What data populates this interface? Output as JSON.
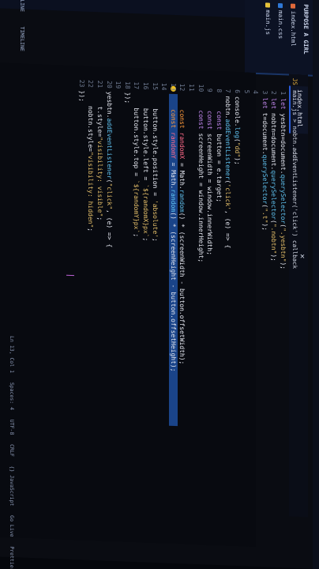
{
  "explorer": {
    "header": "PURPOSE A GIRL",
    "files": [
      {
        "label": "index.html",
        "color": "#e0693a"
      },
      {
        "label": "main.css",
        "color": "#2f78d6"
      },
      {
        "label": "main.js",
        "color": "#e6c23a"
      }
    ],
    "sections": [
      "OUTLINE",
      "TIMELINE"
    ]
  },
  "tab": {
    "label": "index.html"
  },
  "breadcrumb": {
    "file": "main.js",
    "sep1": ">",
    "symbol": "nobtn.addEventListener('click') callback"
  },
  "editor": {
    "lines": [
      {
        "n": "1",
        "tokens": [
          [
            "kw",
            "let "
          ],
          [
            "plain",
            "yesbtn"
          ],
          [
            "plain",
            "="
          ],
          [
            "plain",
            "document."
          ],
          [
            "fn",
            "querySelector"
          ],
          [
            "plain",
            "("
          ],
          [
            "str",
            "\".yesbtn\""
          ],
          [
            "plain",
            ");"
          ]
        ]
      },
      {
        "n": "2",
        "tokens": [
          [
            "kw",
            "let "
          ],
          [
            "plain",
            "nobtn"
          ],
          [
            "plain",
            "="
          ],
          [
            "plain",
            "document."
          ],
          [
            "fn",
            "querySelector"
          ],
          [
            "plain",
            "("
          ],
          [
            "str",
            "\".nobtn\""
          ],
          [
            "plain",
            ");"
          ]
        ]
      },
      {
        "n": "3",
        "tokens": [
          [
            "kw",
            "let "
          ],
          [
            "plain",
            "t"
          ],
          [
            "plain",
            "="
          ],
          [
            "plain",
            "document."
          ],
          [
            "fn",
            "querySelector"
          ],
          [
            "plain",
            "("
          ],
          [
            "str",
            "\".t\""
          ],
          [
            "plain",
            ");"
          ]
        ]
      },
      {
        "n": "4",
        "tokens": []
      },
      {
        "n": "5",
        "tokens": []
      },
      {
        "n": "6",
        "tokens": [
          [
            "plain",
            "console."
          ],
          [
            "fn",
            "log"
          ],
          [
            "plain",
            "("
          ],
          [
            "str",
            "\"dd\""
          ],
          [
            "plain",
            ");"
          ]
        ]
      },
      {
        "n": "7",
        "tokens": [
          [
            "plain",
            "nobtn."
          ],
          [
            "fn",
            "addEventListener"
          ],
          [
            "plain",
            "("
          ],
          [
            "str",
            "'click'"
          ],
          [
            "plain",
            ", (e) => {"
          ]
        ]
      },
      {
        "n": "8",
        "tokens": [
          [
            "kw",
            "    const "
          ],
          [
            "plain",
            "button = e.target;"
          ]
        ]
      },
      {
        "n": "9",
        "tokens": [
          [
            "kw",
            "    const "
          ],
          [
            "plain",
            "screenWidth = window.innerWidth;"
          ]
        ]
      },
      {
        "n": "10",
        "tokens": [
          [
            "kw",
            "    const "
          ],
          [
            "plain",
            "screenHeight = window.innerHeight;"
          ]
        ]
      },
      {
        "n": "11",
        "tokens": []
      },
      {
        "n": "12",
        "tokens": [
          [
            "orange",
            "    const "
          ],
          [
            "var",
            "randomX"
          ],
          [
            "plain",
            " = Math."
          ],
          [
            "fn",
            "random"
          ],
          [
            "plain",
            "() * (screenWidth - button.offsetWidth);"
          ]
        ]
      },
      {
        "n": "13",
        "tokens": [
          [
            "orange",
            "    const "
          ],
          [
            "var",
            "randomY"
          ],
          [
            "plain",
            " = Math."
          ],
          [
            "fn",
            "random"
          ],
          [
            "plain",
            "() * (screenHeight - button.offsetHeight);"
          ]
        ]
      },
      {
        "n": "14",
        "tokens": []
      },
      {
        "n": "15",
        "tokens": [
          [
            "plain",
            "    button.style.position = "
          ],
          [
            "str",
            "'absolute'"
          ],
          [
            "plain",
            ";"
          ]
        ]
      },
      {
        "n": "16",
        "tokens": [
          [
            "plain",
            "    button.style.left = "
          ],
          [
            "str",
            "`${randomX}px`"
          ],
          [
            "plain",
            ";"
          ]
        ]
      },
      {
        "n": "17",
        "tokens": [
          [
            "plain",
            "    button.style.top = "
          ],
          [
            "str",
            "`${randomY}px`"
          ],
          [
            "plain",
            ";"
          ]
        ]
      },
      {
        "n": "18",
        "tokens": [
          [
            "plain",
            "});"
          ]
        ]
      },
      {
        "n": "19",
        "tokens": []
      },
      {
        "n": "20",
        "tokens": [
          [
            "plain",
            "yesbtn."
          ],
          [
            "fn",
            "addEventListener"
          ],
          [
            "plain",
            "("
          ],
          [
            "str",
            "\"click\""
          ],
          [
            "plain",
            ", (e) => {"
          ]
        ]
      },
      {
        "n": "21",
        "tokens": [
          [
            "plain",
            "    t.style="
          ],
          [
            "str",
            "\"visibility: visible\""
          ],
          [
            "plain",
            ";"
          ]
        ]
      },
      {
        "n": "22",
        "tokens": [
          [
            "plain",
            "    nobtn.style="
          ],
          [
            "str",
            "\"visibility: hidden\""
          ],
          [
            "plain",
            ";"
          ]
        ]
      },
      {
        "n": "23",
        "tokens": [
          [
            "plain",
            "});"
          ]
        ]
      }
    ],
    "cursor_line": "13"
  },
  "statusbar": {
    "position": "Ln 13, Col 1",
    "spaces": "Spaces: 4",
    "encoding": "UTF-8",
    "eol": "CRLF",
    "language": "{} JavaScript",
    "golive": "Go Live",
    "prettier": "Prettier"
  }
}
